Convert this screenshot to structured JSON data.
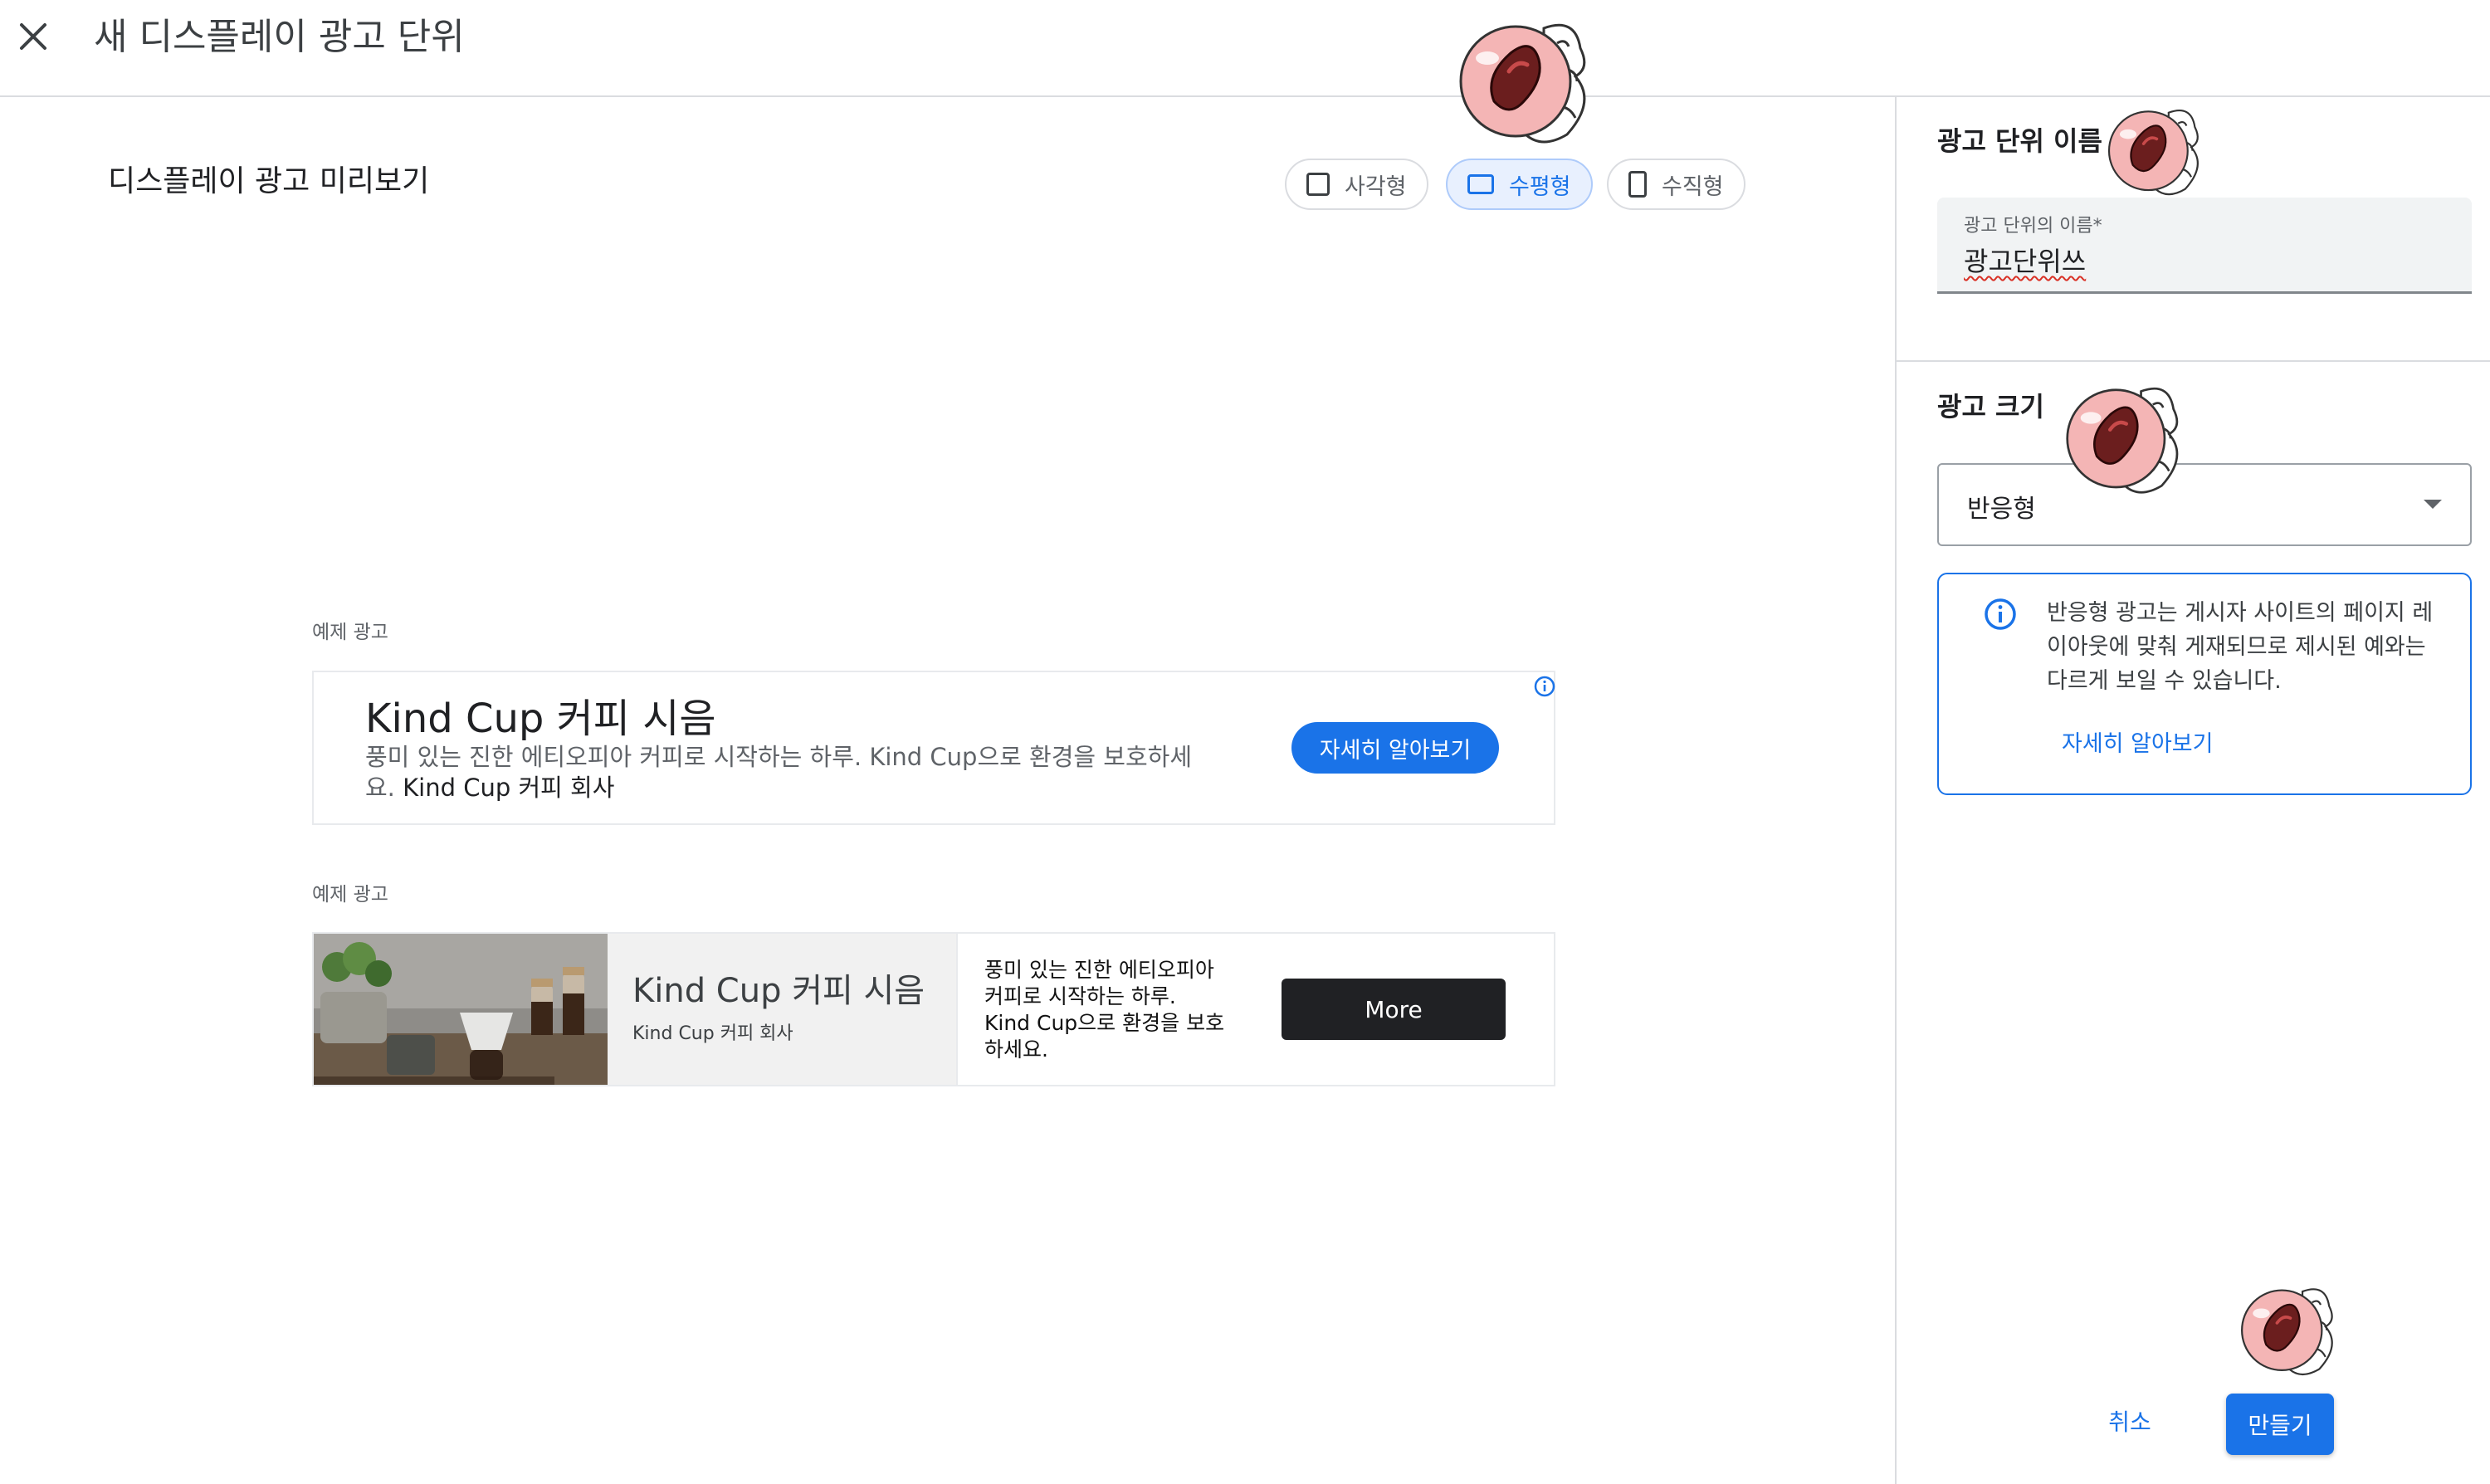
{
  "header": {
    "title": "새 디스플레이 광고 단위",
    "close_icon": "close-icon"
  },
  "preview": {
    "title": "디스플레이 광고 미리보기",
    "chips": [
      {
        "label": "사각형",
        "icon": "square-outline-icon",
        "selected": false
      },
      {
        "label": "수평형",
        "icon": "horizontal-rect-icon",
        "selected": true
      },
      {
        "label": "수직형",
        "icon": "vertical-rect-icon",
        "selected": false
      }
    ]
  },
  "sample_ad_1": {
    "label": "예제 광고",
    "headline": "Kind Cup 커피 시음",
    "description": "풍미 있는 진한 에티오피아 커피로 시작하는 하루. Kind Cup으로 환경을 보호하세요.",
    "brand": "Kind Cup 커피 회사",
    "cta": "자세히 알아보기",
    "info_icon": "adchoices-info-icon"
  },
  "sample_ad_2": {
    "label": "예제 광고",
    "image": "coffee-product-image",
    "headline": "Kind Cup 커피 시음",
    "brand": "Kind Cup 커피 회사",
    "description": "풍미 있는 진한 에티오피아 커피로 시작하는 하루. Kind Cup으로 환경을 보호하세요.",
    "cta": "More"
  },
  "ad_unit_name": {
    "section_title": "광고 단위 이름",
    "field_label": "광고 단위의 이름*",
    "field_value": "광고단위쓰"
  },
  "ad_size": {
    "section_title": "광고 크기",
    "selected": "반응형",
    "notice_text": "반응형 광고는 게시자 사이트의 페이지 레이아웃에 맞춰 게재되므로 제시된 예와는 다르게 보일 수 있습니다.",
    "notice_link": "자세히 알아보기",
    "notice_icon": "info-icon"
  },
  "footer": {
    "cancel": "취소",
    "create": "만들기"
  },
  "colors": {
    "accent": "#1a73e8",
    "chip_selected_bg": "#e8f0fe",
    "dark_button": "#202124",
    "sticker_pink": "#f4b5b5",
    "sticker_dark": "#6b1e1e"
  }
}
